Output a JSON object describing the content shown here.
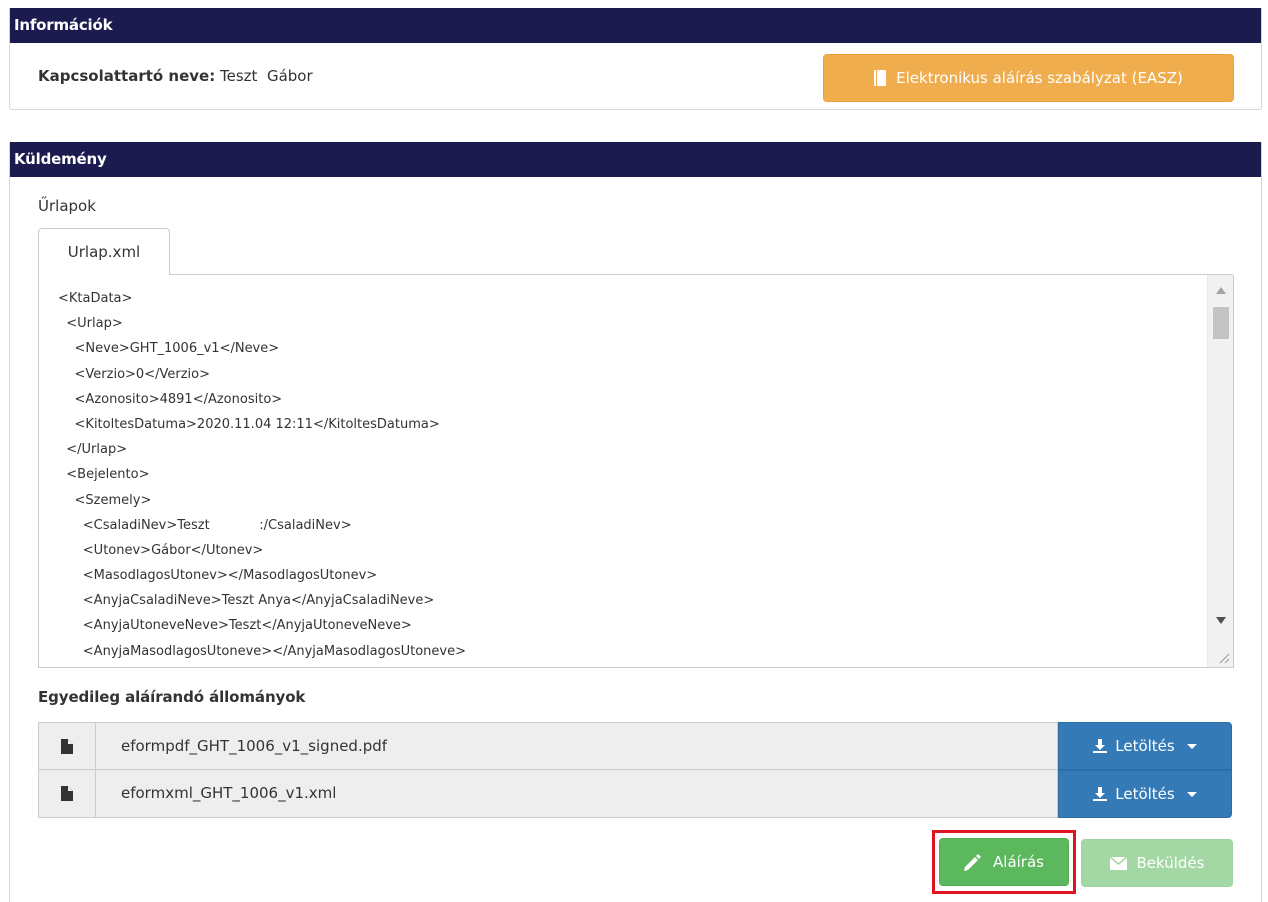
{
  "info_panel": {
    "title": "Információk",
    "contact_label": "Kapcsolattartó neve:",
    "contact_value": "Teszt  Gábor",
    "easz_button": "Elektronikus aláírás szabályzat (EASZ)"
  },
  "kuldemeny_panel": {
    "title": "Küldemény",
    "forms_label": "Űrlapok",
    "tab_label": "Urlap.xml",
    "xml_lines": [
      "<KtaData>",
      "  <Urlap>",
      "    <Neve>GHT_1006_v1</Neve>",
      "    <Verzio>0</Verzio>",
      "    <Azonosito>4891</Azonosito>",
      "    <KitoltesDatuma>2020.11.04 12:11</KitoltesDatuma>",
      "  </Urlap>",
      "  <Bejelento>",
      "    <Szemely>",
      "      <CsaladiNev>Teszt            :/CsaladiNev>",
      "      <Utonev>Gábor</Utonev>",
      "      <MasodlagosUtonev></MasodlagosUtonev>",
      "      <AnyjaCsaladiNeve>Teszt Anya</AnyjaCsaladiNeve>",
      "      <AnyjaUtoneveNeve>Teszt</AnyjaUtoneveNeve>",
      "      <AnyjaMasodlagosUtoneve></AnyjaMasodlagosUtoneve>"
    ],
    "individual_files_label": "Egyedileg aláírandó állományok",
    "files": [
      {
        "name": "eformpdf_GHT_1006_v1_signed.pdf",
        "download_label": "Letöltés"
      },
      {
        "name": "eformxml_GHT_1006_v1.xml",
        "download_label": "Letöltés"
      }
    ],
    "sign_button": "Aláírás",
    "send_button": "Beküldés"
  },
  "colors": {
    "header_bg": "#1b1b50",
    "warning": "#f0ad4e",
    "primary": "#337ab7",
    "success": "#5cb85c",
    "success_disabled": "#a3d7a3",
    "highlight": "#e0141e"
  }
}
